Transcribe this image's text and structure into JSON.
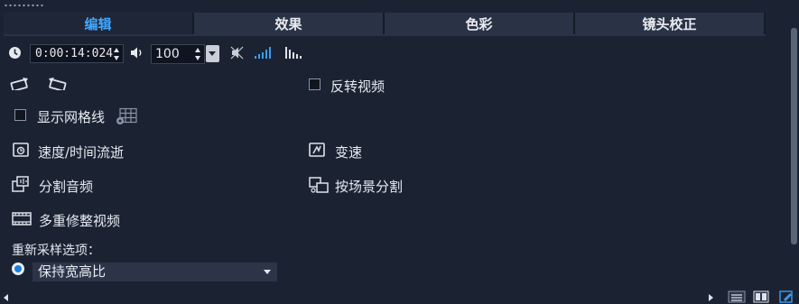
{
  "tabs": [
    {
      "label": "编辑",
      "active": true
    },
    {
      "label": "效果",
      "active": false
    },
    {
      "label": "色彩",
      "active": false
    },
    {
      "label": "镜头校正",
      "active": false
    }
  ],
  "toolbar": {
    "timecode": "0:00:14:024",
    "volume": "100"
  },
  "options": {
    "reverse_video": "反转视频",
    "show_grid": "显示网格线",
    "speed_time_lapse": "速度/时间流逝",
    "variable_speed": "变速",
    "split_audio": "分割音频",
    "split_by_scene": "按场景分割",
    "multi_trim": "多重修整视频"
  },
  "resample": {
    "label": "重新采样选项：",
    "selected": "保持宽高比"
  },
  "colors": {
    "background": "#1b2333",
    "accent": "#41a8ff",
    "tab_inactive": "#2a3345"
  }
}
